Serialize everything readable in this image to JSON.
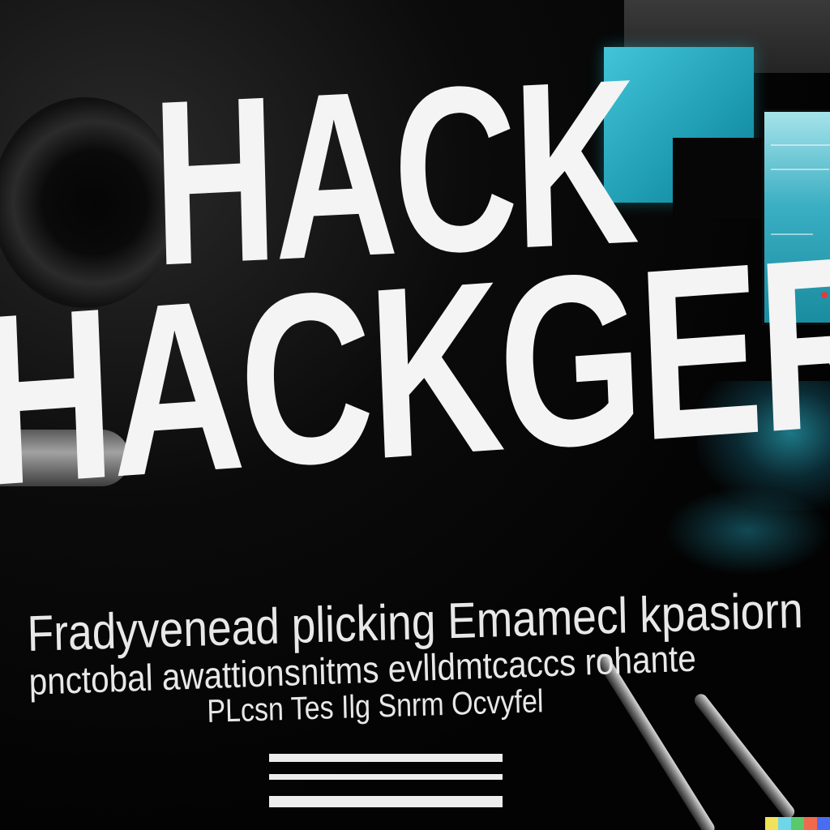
{
  "headline": {
    "line1": "HACK",
    "line2": "HACKGER"
  },
  "body": {
    "line1": "Fradyvenead plicking Emamecl kpasiorn",
    "line2": "pnctobal awattionsnitms evlldmtcaccs rohante",
    "line3": "PLcsn Tes Ilg Snrm Ocvyfel"
  },
  "colors": {
    "background": "#050505",
    "text": "#f4f4f4",
    "cyan_accent": "#2fb3c8"
  },
  "watermark": {
    "colors": [
      "#f2e25a",
      "#6fd6e8",
      "#5ac96b",
      "#f26a4e",
      "#4a6cf0"
    ]
  }
}
